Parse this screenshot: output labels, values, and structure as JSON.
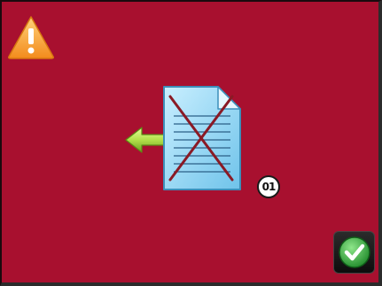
{
  "screen": {
    "background_color": "#a8102f",
    "warning_icon": "warning-triangle-icon",
    "status_graphic": {
      "document_icon": "document-crossed-icon",
      "arrow_icon": "back-arrow-icon",
      "code": "01"
    },
    "confirm_button_icon": "checkmark-icon",
    "accent_colors": {
      "warning": "#f7a23a",
      "arrow": "#9acd32",
      "document": "#8fd3f2",
      "cross": "#8a1a25",
      "confirm": "#3cb043"
    }
  }
}
